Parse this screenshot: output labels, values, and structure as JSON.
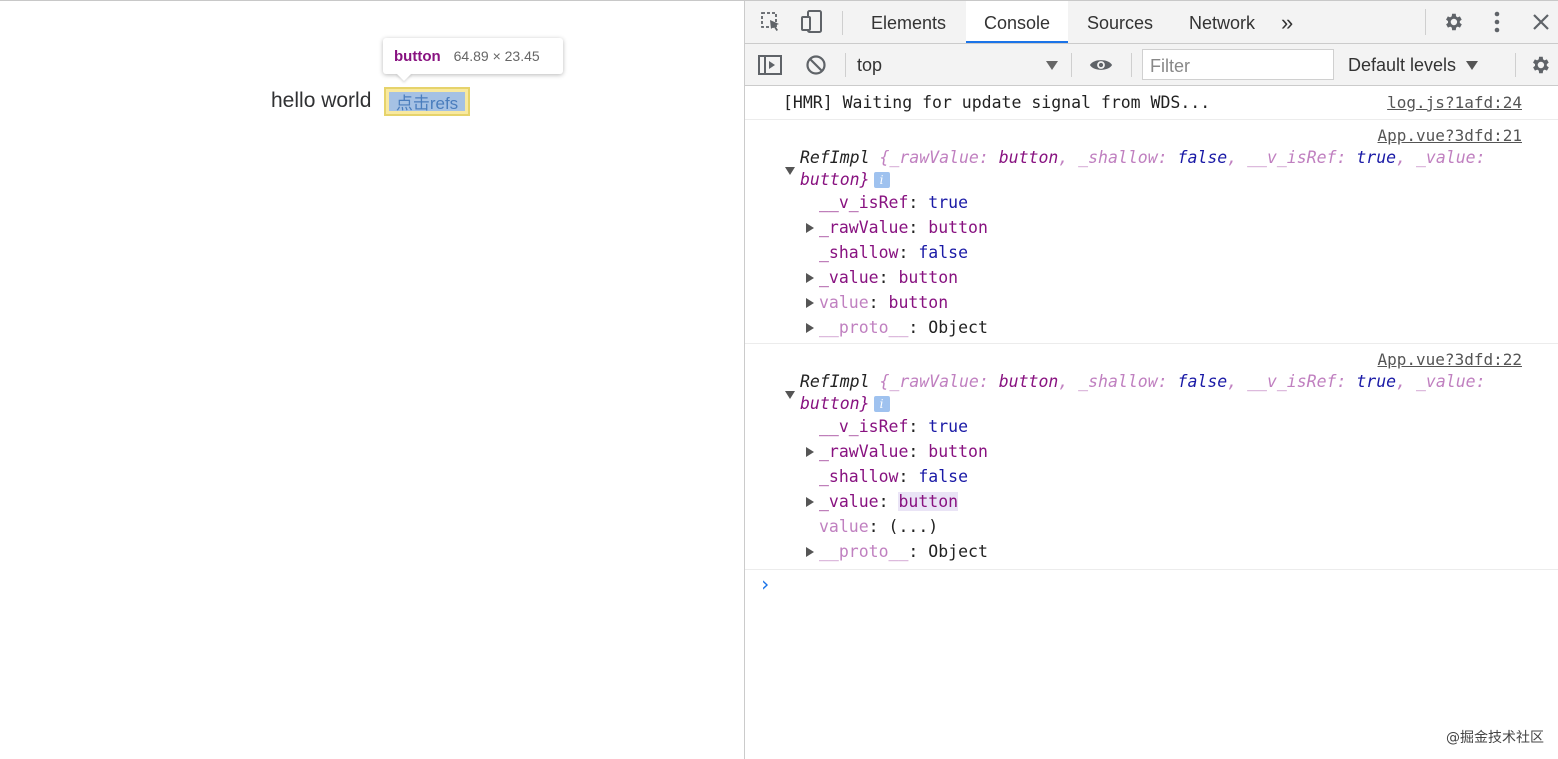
{
  "page": {
    "hello_text": "hello world",
    "button_label": "点击refs",
    "inspect_tooltip": {
      "tag": "button",
      "dimensions": "64.89 × 23.45"
    }
  },
  "devtools": {
    "tabs": [
      "Elements",
      "Console",
      "Sources",
      "Network"
    ],
    "active_tab": "Console",
    "overflow_glyph": "»",
    "toolbar": {
      "context": "top",
      "filter_placeholder": "Filter",
      "levels": "Default levels"
    },
    "icons": [
      "inspect-element-icon",
      "device-toolbar-icon",
      "settings-gear-icon",
      "more-vert-icon",
      "close-icon",
      "sidebar-toggle-icon",
      "clear-console-icon",
      "live-expression-eye-icon",
      "console-settings-gear-icon"
    ]
  },
  "console": {
    "hmr": {
      "text": "[HMR] Waiting for update signal from WDS...",
      "source": "log.js?1afd:24"
    },
    "logs": [
      {
        "source": "App.vue?3dfd:21",
        "summary_head": "RefImpl",
        "summary_parts": [
          "{_rawValue: ",
          "button",
          ", _shallow: ",
          "false",
          ", __v_isRef: ",
          "true",
          ", _value: "
        ],
        "summary_tail": "button}",
        "props": [
          {
            "key": "__v_isRef",
            "value": "true"
          },
          {
            "key": "_rawValue",
            "value": "button"
          },
          {
            "key": "_shallow",
            "value": "false"
          },
          {
            "key": "_value",
            "value": "button"
          },
          {
            "key": "value",
            "value": "button"
          },
          {
            "key": "__proto__",
            "value": "Object"
          }
        ]
      },
      {
        "source": "App.vue?3dfd:22",
        "summary_head": "RefImpl",
        "summary_parts": [
          "{_rawValue: ",
          "button",
          ", _shallow: ",
          "false",
          ", __v_isRef: ",
          "true",
          ", _value: "
        ],
        "summary_tail": "button}",
        "props": [
          {
            "key": "__v_isRef",
            "value": "true"
          },
          {
            "key": "_rawValue",
            "value": "button"
          },
          {
            "key": "_shallow",
            "value": "false"
          },
          {
            "key": "_value",
            "value": "button"
          },
          {
            "key": "value",
            "value": "(...)"
          },
          {
            "key": "__proto__",
            "value": "Object"
          }
        ]
      }
    ],
    "prompt": "›"
  },
  "watermark": "@掘金技术社区"
}
